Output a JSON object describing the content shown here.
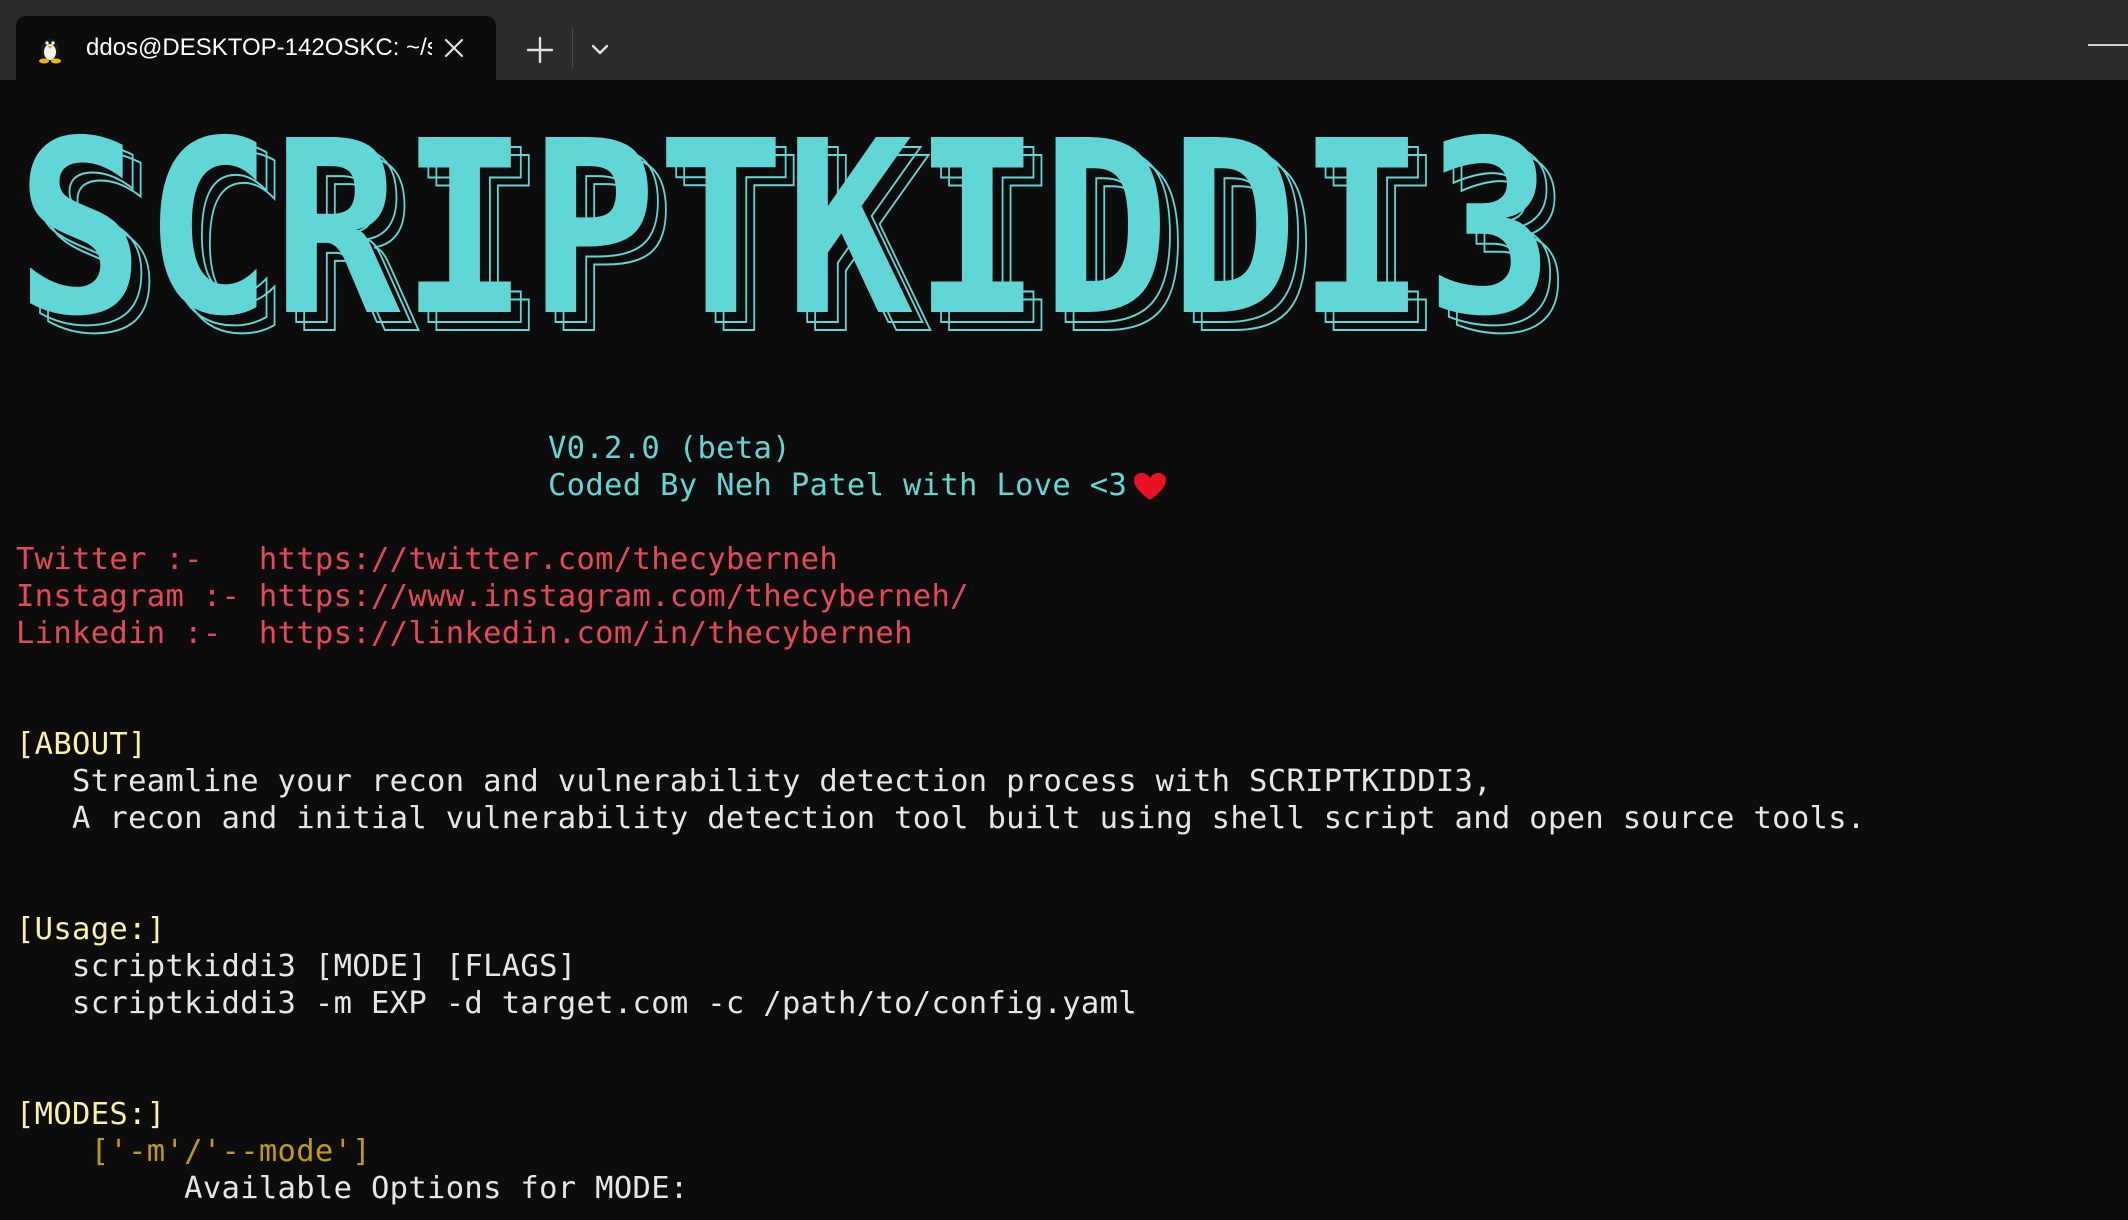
{
  "window": {
    "tab_title": "ddos@DESKTOP-142OSKC: ~/s",
    "tab_icon": "linux-penguin-icon",
    "new_tab_icon": "plus-icon",
    "dropdown_icon": "chevron-down-icon",
    "minimize_icon": "minimize-icon"
  },
  "banner": {
    "text": "SCRIPTKIDDI3"
  },
  "info": {
    "version": "V0.2.0 (beta)",
    "credit": "Coded By Neh Patel with Love <3"
  },
  "socials": [
    {
      "label": "Twitter :-   ",
      "url": "https://twitter.com/thecyberneh"
    },
    {
      "label": "Instagram :- ",
      "url": "https://www.instagram.com/thecyberneh/"
    },
    {
      "label": "Linkedin :-  ",
      "url": "https://linkedin.com/in/thecyberneh"
    }
  ],
  "about": {
    "header": "[ABOUT]",
    "lines": [
      "   Streamline your recon and vulnerability detection process with SCRIPTKIDDI3,",
      "   A recon and initial vulnerability detection tool built using shell script and open source tools."
    ]
  },
  "usage": {
    "header": "[Usage:]",
    "lines": [
      "   scriptkiddi3 [MODE] [FLAGS]",
      "   scriptkiddi3 -m EXP -d target.com -c /path/to/config.yaml"
    ]
  },
  "modes": {
    "header": "[MODES:]",
    "flag": "    ['-m'/'--mode']",
    "desc": "         Available Options for MODE:"
  },
  "colors": {
    "background": "#0c0c0c",
    "cyan": "#61d6d6",
    "red": "#e74856",
    "yellow": "#f9f1a5",
    "gold": "#c19c00",
    "white": "#e6e6e6"
  }
}
